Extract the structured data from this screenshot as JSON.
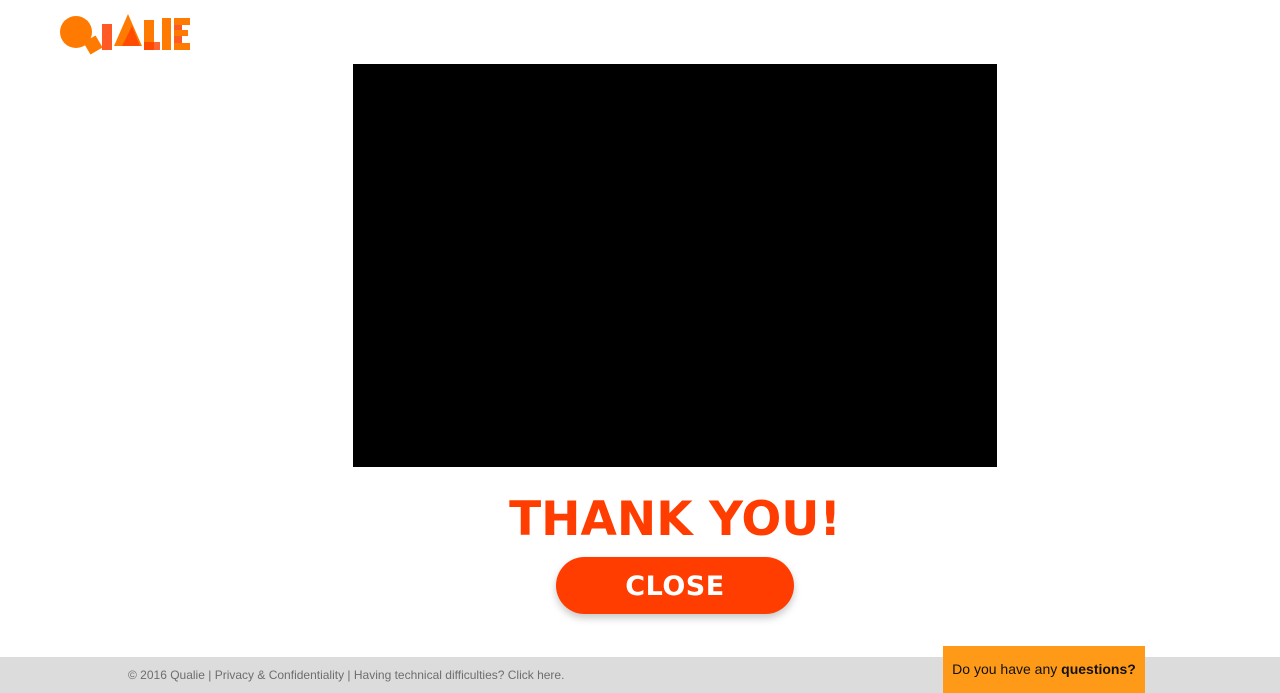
{
  "logo": {
    "alt": "Qualie",
    "colors": {
      "primary": "#ff7a00",
      "accent": "#ff3d00"
    }
  },
  "video": {
    "background": "#000000"
  },
  "main": {
    "heading": "THANK YOU!",
    "close_label": "CLOSE"
  },
  "footer": {
    "copyright": "© 2016 Qualie",
    "separator": " | ",
    "privacy_link": "Privacy & Confidentiality",
    "tech_link": "Having technical difficulties? Click here."
  },
  "questions_tab": {
    "prefix": "Do you have any ",
    "emphasis": "questions?"
  },
  "colors": {
    "accent": "#ff3d00",
    "tab": "#ff9a18",
    "footer_bg": "#dcdcdc"
  }
}
